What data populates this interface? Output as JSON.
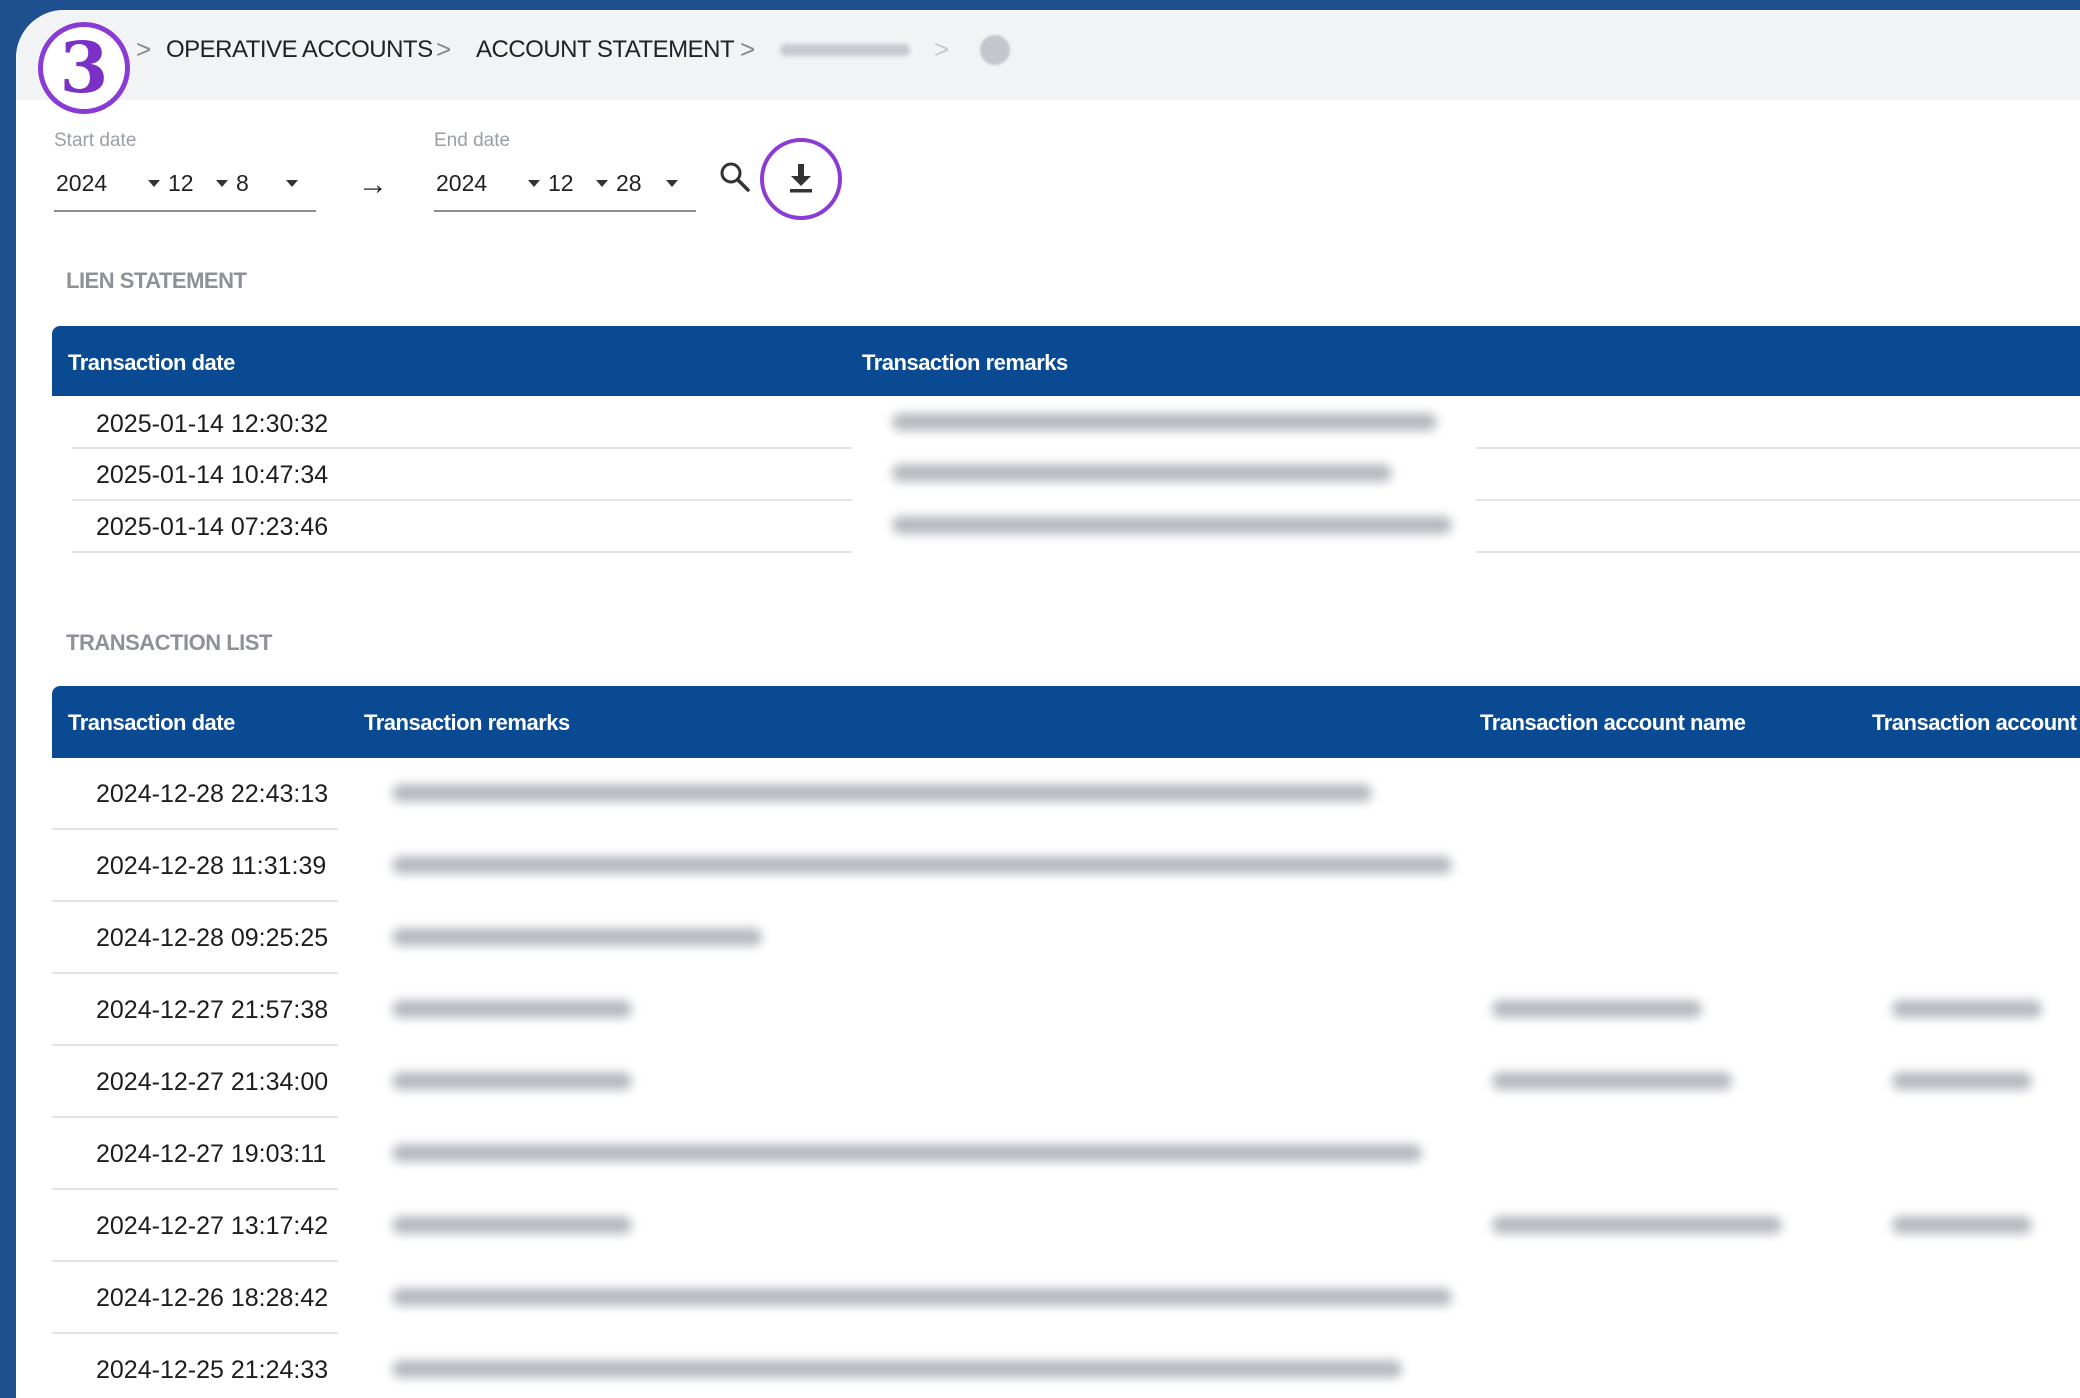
{
  "breadcrumb": {
    "items": [
      "OPERATIVE ACCOUNTS",
      "ACCOUNT STATEMENT"
    ],
    "separator": ">"
  },
  "step_badge": "3",
  "filters": {
    "start_label": "Start date",
    "start": {
      "year": "2024",
      "month": "12",
      "day": "8"
    },
    "end_label": "End date",
    "end": {
      "year": "2024",
      "month": "12",
      "day": "28"
    },
    "range_arrow": "→"
  },
  "lien": {
    "title": "LIEN STATEMENT",
    "columns": [
      "Transaction date",
      "Transaction remarks"
    ],
    "rows": [
      {
        "date": "2025-01-14 12:30:32"
      },
      {
        "date": "2025-01-14 10:47:34"
      },
      {
        "date": "2025-01-14 07:23:46"
      }
    ]
  },
  "transactions": {
    "title": "TRANSACTION LIST",
    "columns": [
      "Transaction date",
      "Transaction remarks",
      "Transaction account name",
      "Transaction account r"
    ],
    "rows": [
      {
        "date": "2024-12-28 22:43:13"
      },
      {
        "date": "2024-12-28 11:31:39"
      },
      {
        "date": "2024-12-28 09:25:25"
      },
      {
        "date": "2024-12-27 21:57:38"
      },
      {
        "date": "2024-12-27 21:34:00"
      },
      {
        "date": "2024-12-27 19:03:11"
      },
      {
        "date": "2024-12-27 13:17:42"
      },
      {
        "date": "2024-12-26 18:28:42"
      },
      {
        "date": "2024-12-25 21:24:33"
      }
    ]
  },
  "colors": {
    "header_blue": "#0a4a93",
    "highlight_purple": "#8a3bd6",
    "background_blue": "#1e4f8f"
  },
  "icons": [
    "home-icon",
    "search-icon",
    "download-icon",
    "calendar-dropdown-caret"
  ]
}
